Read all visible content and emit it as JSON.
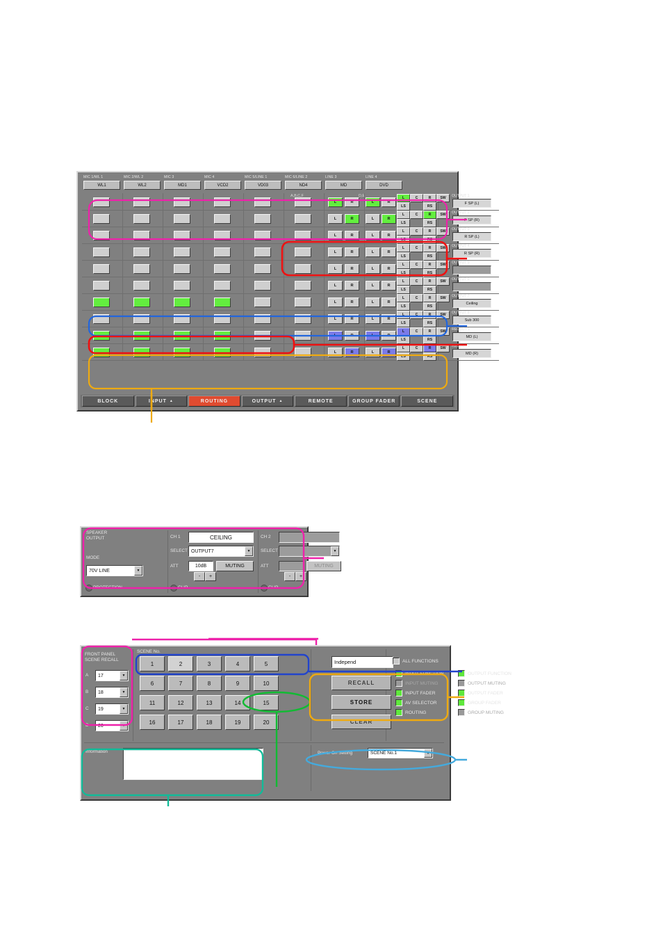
{
  "routing": {
    "input_columns": [
      {
        "caption": "MIC 1/WL 1",
        "name": "WL1"
      },
      {
        "caption": "MIC 2/WL 2",
        "name": "WL2"
      },
      {
        "caption": "MIC 3",
        "name": "MD1"
      },
      {
        "caption": "MIC 4",
        "name": "VCD2"
      },
      {
        "caption": "MIC 5/LINE 1",
        "name": "VD03"
      },
      {
        "caption": "MIC 6/LINE 2",
        "name": "ND4"
      },
      {
        "caption": "LINE 3",
        "name": "MD"
      },
      {
        "caption": "LINE 4",
        "name": "DVD"
      }
    ],
    "group_labels": {
      "abcf": "A,B,C,F",
      "de": "D,E"
    },
    "surround_labels": {
      "l": "L",
      "c": "C",
      "r": "R",
      "sw": "SW",
      "ls": "LS",
      "rs": "RS"
    },
    "lr_labels": {
      "l": "L",
      "r": "R"
    },
    "rows": [
      {
        "output_label": "OUTPUT 1",
        "output_name": "F SP (L)",
        "mic": [
          0,
          0,
          0,
          0,
          0,
          0
        ],
        "line3": {
          "l": 1,
          "r": 0
        },
        "line4": {
          "l": 1,
          "r": 0
        },
        "sur": {
          "l": 1,
          "c": 0,
          "r": 0,
          "sw": 0,
          "ls": 0,
          "rs": 0
        }
      },
      {
        "output_label": "OUTPUT 2",
        "output_name": "F SP (R)",
        "mic": [
          0,
          0,
          0,
          0,
          0,
          0
        ],
        "line3": {
          "l": 0,
          "r": 1
        },
        "line4": {
          "l": 0,
          "r": 1
        },
        "sur": {
          "l": 0,
          "c": 0,
          "r": 1,
          "sw": 0,
          "ls": 0,
          "rs": 0
        }
      },
      {
        "output_label": "OUTPUT 3",
        "output_name": "R SP (L)",
        "mic": [
          0,
          0,
          0,
          0,
          0,
          0
        ],
        "line3": {
          "l": 0,
          "r": 0
        },
        "line4": {
          "l": 0,
          "r": 0
        },
        "sur": {
          "l": 0,
          "c": 0,
          "r": 0,
          "sw": 0,
          "ls": 0,
          "rs": 0
        }
      },
      {
        "output_label": "OUTPUT 4",
        "output_name": "R SP (R)",
        "mic": [
          0,
          0,
          0,
          0,
          0,
          0
        ],
        "line3": {
          "l": 0,
          "r": 0
        },
        "line4": {
          "l": 0,
          "r": 0
        },
        "sur": {
          "l": 0,
          "c": 0,
          "r": 0,
          "sw": 0,
          "ls": 0,
          "rs": 0
        }
      },
      {
        "output_label": "OUTPUT 5",
        "output_name": "",
        "mic": [
          0,
          0,
          0,
          0,
          0,
          0
        ],
        "line3": {
          "l": 0,
          "r": 0
        },
        "line4": {
          "l": 0,
          "r": 0
        },
        "sur": {
          "l": 0,
          "c": 0,
          "r": 0,
          "sw": 0,
          "ls": 0,
          "rs": 0
        }
      },
      {
        "output_label": "OUTPUT 6",
        "output_name": "",
        "mic": [
          0,
          0,
          0,
          0,
          0,
          0
        ],
        "line3": {
          "l": 0,
          "r": 0
        },
        "line4": {
          "l": 0,
          "r": 0
        },
        "sur": {
          "l": 0,
          "c": 0,
          "r": 0,
          "sw": 0,
          "ls": 0,
          "rs": 0
        }
      },
      {
        "output_label": "OUTPUT 7",
        "output_name": "Ceiling",
        "mic": [
          1,
          1,
          1,
          1,
          0,
          0
        ],
        "line3": {
          "l": 0,
          "r": 0
        },
        "line4": {
          "l": 0,
          "r": 0
        },
        "sur": {
          "l": 0,
          "c": 0,
          "r": 0,
          "sw": 0,
          "ls": 0,
          "rs": 0
        }
      },
      {
        "output_label": "OUTPUT 8",
        "output_name": "Sub 300",
        "mic": [
          0,
          0,
          0,
          0,
          0,
          0
        ],
        "line3": {
          "l": 0,
          "r": 0
        },
        "line4": {
          "l": 0,
          "r": 0
        },
        "sur": {
          "l": 0,
          "c": 0,
          "r": 0,
          "sw": 0,
          "ls": 0,
          "rs": 0
        }
      },
      {
        "output_label": "RECOUT 1",
        "output_name": "MD (L)",
        "mic": [
          1,
          1,
          1,
          1,
          0,
          0
        ],
        "line3": {
          "l": 2,
          "r": 0
        },
        "line4": {
          "l": 2,
          "r": 0
        },
        "sur": {
          "l": 2,
          "c": 0,
          "r": 0,
          "sw": 0,
          "ls": 0,
          "rs": 0
        }
      },
      {
        "output_label": "RECOUT 2",
        "output_name": "MD (R)",
        "mic": [
          1,
          1,
          1,
          1,
          0,
          0
        ],
        "line3": {
          "l": 0,
          "r": 2
        },
        "line4": {
          "l": 0,
          "r": 2
        },
        "sur": {
          "l": 0,
          "c": 0,
          "r": 2,
          "sw": 0,
          "ls": 0,
          "rs": 0
        }
      }
    ],
    "tabs": [
      {
        "label": "BLOCK",
        "arrow": "",
        "active": false
      },
      {
        "label": "INPUT",
        "arrow": "▲",
        "active": false
      },
      {
        "label": "ROUTING",
        "arrow": "",
        "active": true
      },
      {
        "label": "OUTPUT",
        "arrow": "▲",
        "active": false
      },
      {
        "label": "REMOTE",
        "arrow": "",
        "active": false
      },
      {
        "label": "GROUP FADER",
        "arrow": "",
        "active": false
      },
      {
        "label": "SCENE",
        "arrow": "",
        "active": false
      }
    ]
  },
  "speaker_output": {
    "title_line1": "SPEAKER",
    "title_line2": "OUTPUT",
    "mode_label": "MODE",
    "mode_value": "70V LINE",
    "protection_label": "PROTECTION",
    "ch1": {
      "label": "CH 1",
      "name": "CEILING",
      "select_label": "SELECT",
      "select_value": "OUTPUT7",
      "att_label": "ATT",
      "att_value": "10dB",
      "muting_label": "MUTING",
      "minus": "-",
      "plus": "+",
      "clip_label": "CLIP"
    },
    "ch2": {
      "label": "CH 2",
      "name": "",
      "select_label": "SELECT",
      "select_value": "",
      "att_label": "ATT",
      "att_value": "",
      "muting_label": "MUTING",
      "minus": "-",
      "plus": "+",
      "clip_label": "CLIP"
    }
  },
  "scene": {
    "front_panel": {
      "title_line1": "FRONT PANEL",
      "title_line2": "SCENE RECALL",
      "rows": [
        {
          "key": "A",
          "value": "17"
        },
        {
          "key": "B",
          "value": "18"
        },
        {
          "key": "C",
          "value": "19"
        },
        {
          "key": "D",
          "value": "20"
        }
      ]
    },
    "scene_no_label": "SCENE No.",
    "buttons": [
      "1",
      "2",
      "3",
      "4",
      "5",
      "6",
      "7",
      "8",
      "9",
      "10",
      "11",
      "12",
      "13",
      "14",
      "15",
      "16",
      "17",
      "18",
      "19",
      "20"
    ],
    "selected_button": "2",
    "name_field_value": "Independ",
    "actions": [
      {
        "label": "RECALL",
        "enabled": false
      },
      {
        "label": "STORE",
        "enabled": true
      },
      {
        "label": "CLEAR",
        "enabled": false
      }
    ],
    "all_functions_label": "ALL FUNCTIONS",
    "all_functions_checked": false,
    "functions_left": [
      {
        "label": "INPUT FUNCTION",
        "checked": true
      },
      {
        "label": "INPUT MUTING",
        "checked": false
      },
      {
        "label": "INPUT FADER",
        "checked": true
      },
      {
        "label": "AV SELECTOR",
        "checked": true
      },
      {
        "label": "ROUTING",
        "checked": true
      }
    ],
    "functions_right": [
      {
        "label": "OUTPUT FUNCTION",
        "checked": true
      },
      {
        "label": "OUTPUT MUTING",
        "checked": false
      },
      {
        "label": "OUTPUT FADER",
        "checked": true
      },
      {
        "label": "GROUP FADER",
        "checked": true
      },
      {
        "label": "GROUP MUTING",
        "checked": false
      }
    ],
    "information_label": "Information",
    "information_value": "",
    "power_on_label": "Power On Setting",
    "power_on_value": "SCENE No.1"
  },
  "annotation_colors": {
    "magenta": "#ee22aa",
    "red": "#ee1111",
    "blue": "#2266dd",
    "orange": "#eeaa11",
    "green": "#11bb33",
    "teal": "#11bb99",
    "cyan": "#44aadd"
  }
}
